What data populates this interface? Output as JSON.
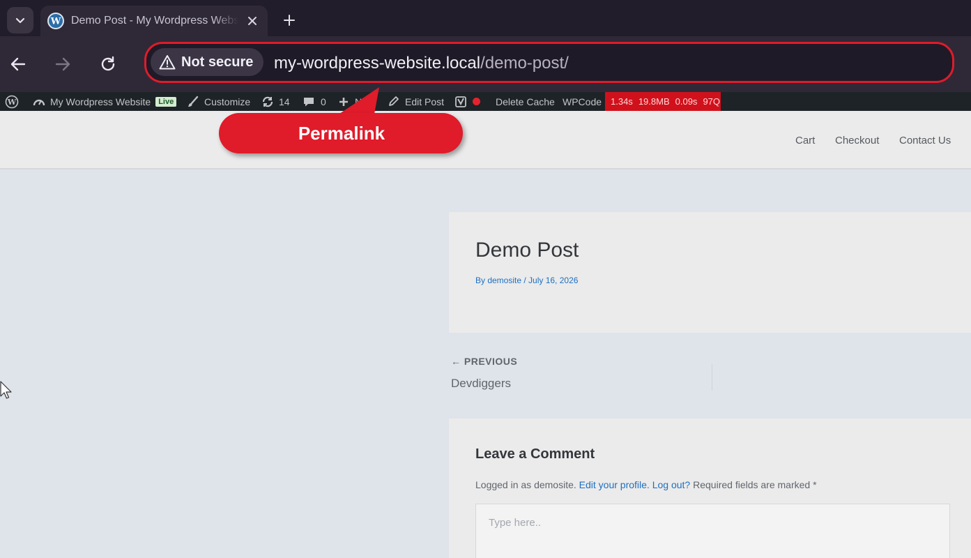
{
  "browser": {
    "tab": {
      "title": "Demo Post - My Wordpress Website"
    },
    "address": {
      "security_label": "Not secure",
      "url_host": "my-wordpress-website.local",
      "url_path": "/demo-post/"
    }
  },
  "admin_bar": {
    "site_name": "My Wordpress Website",
    "live_badge": "Live",
    "customize": "Customize",
    "updates_count": "14",
    "comments_count": "0",
    "new_label": "N",
    "edit_post": "Edit Post",
    "delete_cache": "Delete Cache",
    "wpcode": "WPCode",
    "perf": {
      "time": "1.34s",
      "memory": "19.8MB",
      "db_time": "0.09s",
      "queries": "97Q"
    }
  },
  "site_nav": {
    "items": [
      {
        "label": "Cart"
      },
      {
        "label": "Checkout"
      },
      {
        "label": "Contact Us"
      }
    ]
  },
  "callout": {
    "text": "Permalink"
  },
  "post": {
    "title": "Demo Post",
    "meta": "By demosite / July 16, 2026"
  },
  "post_nav": {
    "previous_label": "← PREVIOUS",
    "previous_title": "Devdiggers"
  },
  "comment": {
    "title": "Leave a Comment",
    "logged_in_prefix": "Logged in as demosite.",
    "edit_profile": "Edit your profile.",
    "log_out": "Log out?",
    "required_text": "Required fields are marked *",
    "placeholder": "Type here.."
  },
  "colors": {
    "accent_red": "#e01b2a",
    "link_blue": "#1e6fc1",
    "admin_bar": "#1d2327"
  }
}
